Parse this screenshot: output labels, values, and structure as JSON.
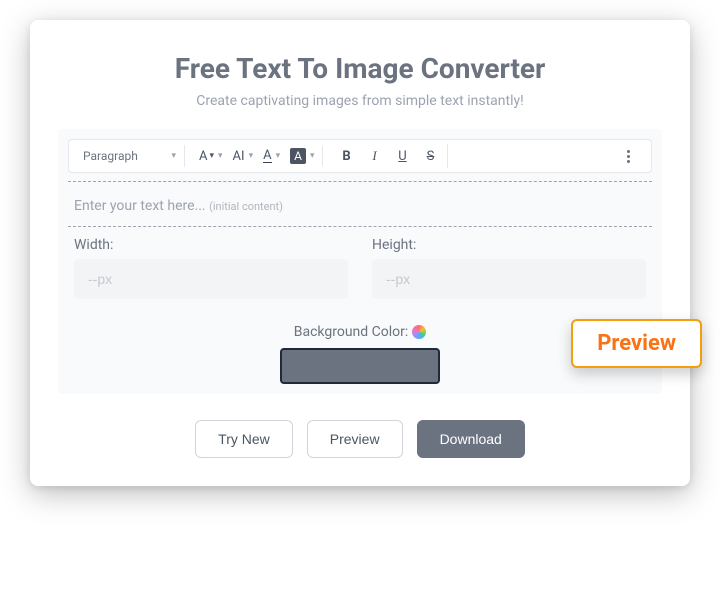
{
  "title": "Free Text To Image Converter",
  "subtitle": "Create captivating images from simple text instantly!",
  "toolbar": {
    "paragraph": "Paragraph",
    "font_family_label": "A",
    "font_size_label": "AI",
    "font_color_label": "A",
    "highlight_label": "A",
    "bold": "B",
    "italic": "I",
    "underline": "U",
    "strike": "S"
  },
  "editor": {
    "placeholder_main": "Enter your text here...",
    "placeholder_hint": "(initial content)"
  },
  "dimensions": {
    "width_label": "Width:",
    "width_placeholder": "--px",
    "height_label": "Height:",
    "height_placeholder": "--px"
  },
  "background": {
    "label": "Background Color:",
    "value": "#6b7280"
  },
  "buttons": {
    "try_new": "Try New",
    "preview": "Preview",
    "download": "Download"
  },
  "badge": "Preview"
}
